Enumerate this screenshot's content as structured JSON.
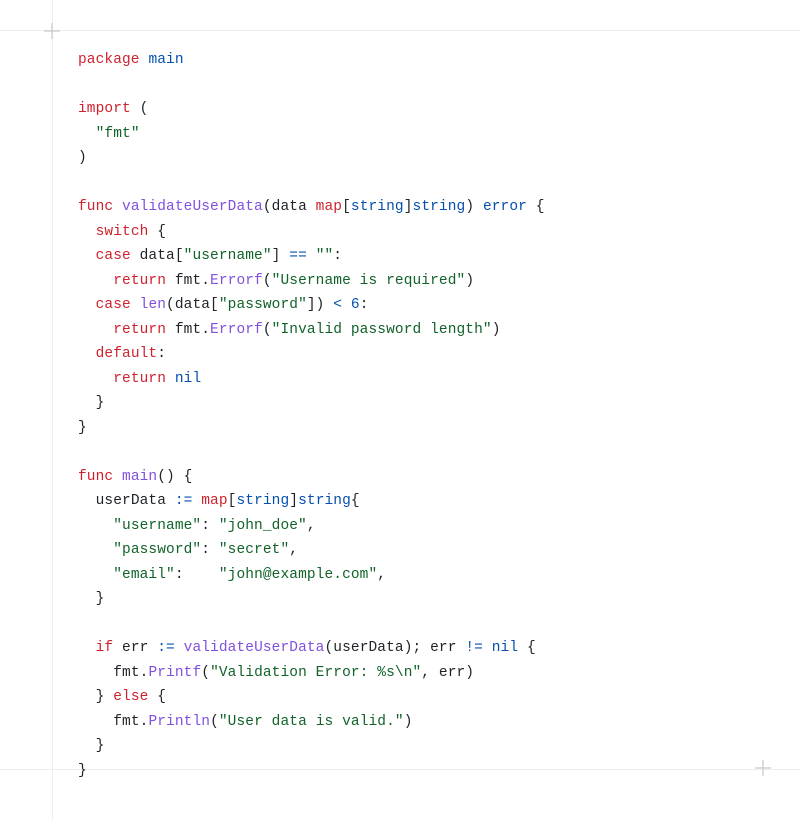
{
  "code": {
    "line1_kw1": "package",
    "line1_id": "main",
    "line3_kw1": "import",
    "line3_paren": " (",
    "line4_indent": "  ",
    "line4_str": "\"fmt\"",
    "line5_close": ")",
    "line7_kw1": "func",
    "line7_fn": "validateUserData",
    "line7_sig1": "(data ",
    "line7_kw2": "map",
    "line7_sig2": "[",
    "line7_type1": "string",
    "line7_sig3": "]",
    "line7_type2": "string",
    "line7_sig4": ") ",
    "line7_type3": "error",
    "line7_sig5": " {",
    "line8_indent": "  ",
    "line8_kw": "switch",
    "line8_rest": " {",
    "line9_indent": "  ",
    "line9_kw": "case",
    "line9_rest1": " data[",
    "line9_str": "\"username\"",
    "line9_rest2": "] ",
    "line9_op": "==",
    "line9_rest3": " ",
    "line9_str2": "\"\"",
    "line9_rest4": ":",
    "line10_indent": "    ",
    "line10_kw": "return",
    "line10_rest1": " fmt.",
    "line10_fn": "Errorf",
    "line10_rest2": "(",
    "line10_str": "\"Username is required\"",
    "line10_rest3": ")",
    "line11_indent": "  ",
    "line11_kw": "case",
    "line11_rest1": " ",
    "line11_fn": "len",
    "line11_rest2": "(data[",
    "line11_str": "\"password\"",
    "line11_rest3": "]) ",
    "line11_op": "<",
    "line11_rest4": " ",
    "line11_num": "6",
    "line11_rest5": ":",
    "line12_indent": "    ",
    "line12_kw": "return",
    "line12_rest1": " fmt.",
    "line12_fn": "Errorf",
    "line12_rest2": "(",
    "line12_str": "\"Invalid password length\"",
    "line12_rest3": ")",
    "line13_indent": "  ",
    "line13_kw": "default",
    "line13_rest": ":",
    "line14_indent": "    ",
    "line14_kw": "return",
    "line14_rest": " ",
    "line14_nil": "nil",
    "line15_indent": "  ",
    "line15_close": "}",
    "line16_close": "}",
    "line18_kw": "func",
    "line18_fn": "main",
    "line18_rest": "() {",
    "line19_indent": "  ",
    "line19_id": "userData ",
    "line19_op": ":=",
    "line19_rest1": " ",
    "line19_kw": "map",
    "line19_rest2": "[",
    "line19_type1": "string",
    "line19_rest3": "]",
    "line19_type2": "string",
    "line19_rest4": "{",
    "line20_indent": "    ",
    "line20_key": "\"username\"",
    "line20_colon": ": ",
    "line20_val": "\"john_doe\"",
    "line20_comma": ",",
    "line21_indent": "    ",
    "line21_key": "\"password\"",
    "line21_colon": ": ",
    "line21_val": "\"secret\"",
    "line21_comma": ",",
    "line22_indent": "    ",
    "line22_key": "\"email\"",
    "line22_colon": ":    ",
    "line22_val": "\"john@example.com\"",
    "line22_comma": ",",
    "line23_indent": "  ",
    "line23_close": "}",
    "line25_indent": "  ",
    "line25_kw1": "if",
    "line25_rest1": " err ",
    "line25_op1": ":=",
    "line25_rest2": " ",
    "line25_fn": "validateUserData",
    "line25_rest3": "(userData); err ",
    "line25_op2": "!=",
    "line25_rest4": " ",
    "line25_nil": "nil",
    "line25_rest5": " {",
    "line26_indent": "    ",
    "line26_rest1": "fmt.",
    "line26_fn": "Printf",
    "line26_rest2": "(",
    "line26_str": "\"Validation Error: %s\\n\"",
    "line26_rest3": ", err)",
    "line27_indent": "  ",
    "line27_close1": "} ",
    "line27_kw": "else",
    "line27_rest": " {",
    "line28_indent": "    ",
    "line28_rest1": "fmt.",
    "line28_fn": "Println",
    "line28_rest2": "(",
    "line28_str": "\"User data is valid.\"",
    "line28_rest3": ")",
    "line29_indent": "  ",
    "line29_close": "}",
    "line30_close": "}"
  }
}
